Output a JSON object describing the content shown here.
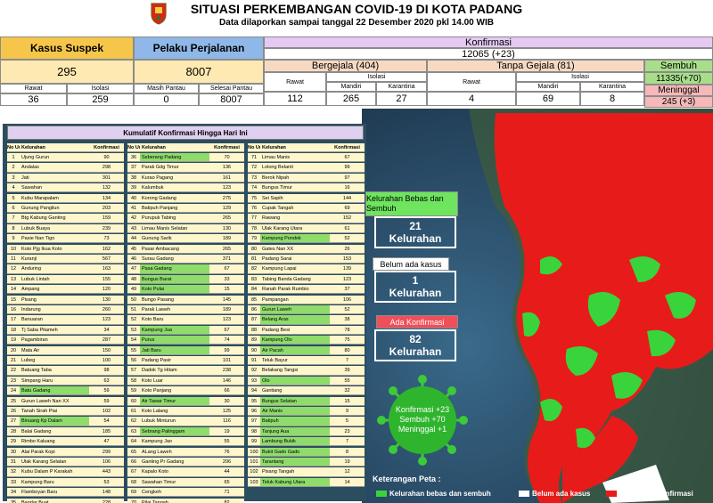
{
  "header": {
    "title": "SITUASI PERKEMBANGAN COVID-19 DI KOTA PADANG",
    "subtitle": "Data dilaporkan sampai tanggal 22 Desember 2020 pkl 14.00 WIB"
  },
  "summary": {
    "kasus_suspek": {
      "label": "Kasus Suspek",
      "total": "295",
      "rawat_label": "Rawat",
      "rawat": "36",
      "isolasi_label": "Isolasi",
      "isolasi": "259"
    },
    "pelaku_perjalanan": {
      "label": "Pelaku Perjalanan",
      "total": "8007",
      "masih_label": "Masih Pantau",
      "masih": "0",
      "selesai_label": "Selesai Pantau",
      "selesai": "8007"
    },
    "konfirmasi": {
      "label": "Konfirmasi",
      "total": "12065 (+23)"
    },
    "bergejala": {
      "label": "Bergejala (404)",
      "rawat_label": "Rawat",
      "rawat": "112",
      "isolasi_label": "Isolasi",
      "mandiri_label": "Mandiri",
      "mandiri": "265",
      "karantina_label": "Karantina",
      "karantina": "27"
    },
    "tanpa_gejala": {
      "label": "Tanpa Gejala (81)",
      "rawat_label": "Rawat",
      "rawat": "4",
      "isolasi_label": "Isolasi",
      "mandiri_label": "Mandiri",
      "mandiri": "69",
      "karantina_label": "Karantina",
      "karantina": "8"
    },
    "sembuh": {
      "label": "Sembuh",
      "value": "11335(+70)"
    },
    "meninggal": {
      "label": "Meninggal",
      "value": "245 (+3)"
    }
  },
  "table": {
    "title": "Kumulatif Konfirmasi Hingga Hari Ini",
    "col_no": "No Urut",
    "col_kel": "Kelurahan",
    "col_konf": "Konfirmasi",
    "col1": [
      [
        "1",
        "Ujung Gurun",
        "90",
        0
      ],
      [
        "2",
        "Andalas",
        "298",
        0
      ],
      [
        "3",
        "Jati",
        "301",
        0
      ],
      [
        "4",
        "Sawahan",
        "132",
        0
      ],
      [
        "5",
        "Kubu Marapalam",
        "134",
        0
      ],
      [
        "6",
        "Gunung Pangilun",
        "203",
        0
      ],
      [
        "7",
        "Btg Kabung Ganting",
        "159",
        0
      ],
      [
        "8",
        "Lubuk Buaya",
        "239",
        0
      ],
      [
        "9",
        "Pasie Nan Tigo",
        "73",
        0
      ],
      [
        "10",
        "Koto Pjg Ikua Koto",
        "162",
        0
      ],
      [
        "11",
        "Kuranji",
        "567",
        0
      ],
      [
        "12",
        "Anduring",
        "163",
        0
      ],
      [
        "13",
        "Lubuk Lintah",
        "155",
        0
      ],
      [
        "14",
        "Ampang",
        "120",
        0
      ],
      [
        "15",
        "Pisang",
        "130",
        0
      ],
      [
        "16",
        "Indarung",
        "260",
        0
      ],
      [
        "17",
        "Banuaran",
        "123",
        0
      ],
      [
        "18",
        "Tj Saba Pitameh",
        "34",
        0
      ],
      [
        "19",
        "Pagambiran",
        "287",
        0
      ],
      [
        "20",
        "Mata Air",
        "150",
        0
      ],
      [
        "21",
        "Lubeg",
        "100",
        0
      ],
      [
        "22",
        "Batuang Taba",
        "98",
        0
      ],
      [
        "23",
        "Simpang Haru",
        "63",
        0
      ],
      [
        "24",
        "Batu Gadang",
        "59",
        1
      ],
      [
        "25",
        "Gurun Laweh Nan XX",
        "59",
        0
      ],
      [
        "26",
        "Tanah Sirah Piai",
        "102",
        0
      ],
      [
        "27",
        "Binuang Kp Dalam",
        "54",
        1
      ],
      [
        "28",
        "Balai Gadang",
        "185",
        0
      ],
      [
        "29",
        "Rimbo Kaluang",
        "47",
        0
      ],
      [
        "30",
        "Alai Parak Kopi",
        "299",
        0
      ],
      [
        "31",
        "Ulak Karang Selatan",
        "106",
        0
      ],
      [
        "32",
        "Kubu Dalam P Karakah",
        "443",
        0
      ],
      [
        "33",
        "Kampung Baru",
        "53",
        0
      ],
      [
        "34",
        "Flamboyan Baru",
        "148",
        0
      ],
      [
        "35",
        "Bandar Buat",
        "228",
        0
      ]
    ],
    "col2": [
      [
        "36",
        "Seberang Padang",
        "70",
        1
      ],
      [
        "37",
        "Parak Gdg Timur",
        "136",
        0
      ],
      [
        "38",
        "Kurao Pagang",
        "161",
        0
      ],
      [
        "39",
        "Kalumbuk",
        "123",
        0
      ],
      [
        "40",
        "Korong Gadang",
        "275",
        0
      ],
      [
        "41",
        "Batipuh Panjang",
        "129",
        0
      ],
      [
        "42",
        "Purupuk Tabing",
        "265",
        0
      ],
      [
        "43",
        "Limau Manis Selatan",
        "130",
        0
      ],
      [
        "44",
        "Gunung Sarik",
        "189",
        0
      ],
      [
        "45",
        "Pasar Ambacang",
        "265",
        0
      ],
      [
        "46",
        "Surau Gadang",
        "371",
        0
      ],
      [
        "47",
        "Pasa Gadang",
        "67",
        1
      ],
      [
        "48",
        "Bungus Barat",
        "33",
        1
      ],
      [
        "49",
        "Koto Pulai",
        "15",
        1
      ],
      [
        "50",
        "Bungo Pasang",
        "145",
        0
      ],
      [
        "51",
        "Parak Laweh",
        "189",
        0
      ],
      [
        "52",
        "Koto Baru",
        "123",
        0
      ],
      [
        "53",
        "Kampung Jua",
        "67",
        1
      ],
      [
        "54",
        "Purus",
        "74",
        1
      ],
      [
        "55",
        "Jati Baru",
        "99",
        1
      ],
      [
        "56",
        "Padang Pasir",
        "101",
        0
      ],
      [
        "57",
        "Dadok Tg Hitam",
        "238",
        0
      ],
      [
        "58",
        "Koto Luar",
        "146",
        0
      ],
      [
        "59",
        "Koto Panjang",
        "66",
        0
      ],
      [
        "60",
        "Air Tawar Timur",
        "30",
        1
      ],
      [
        "61",
        "Koto Lalang",
        "125",
        0
      ],
      [
        "62",
        "Lubuk Minturun",
        "116",
        0
      ],
      [
        "63",
        "Sebrang Palinggam",
        "19",
        1
      ],
      [
        "64",
        "Kampung Jao",
        "55",
        0
      ],
      [
        "65",
        "ALang Laweh",
        "76",
        0
      ],
      [
        "66",
        "Ganting Pr Gadang",
        "206",
        0
      ],
      [
        "67",
        "Kapalo Koto",
        "44",
        0
      ],
      [
        "68",
        "Sawahan Timur",
        "65",
        0
      ],
      [
        "69",
        "Cengkeh",
        "71",
        0
      ],
      [
        "70",
        "Pilai Tangah",
        "82",
        0
      ]
    ],
    "col3": [
      [
        "71",
        "Limau Manis",
        "67",
        0
      ],
      [
        "72",
        "Lolong Belanti",
        "99",
        0
      ],
      [
        "73",
        "Berok Nipah",
        "97",
        0
      ],
      [
        "74",
        "Bungus Timur",
        "16",
        0
      ],
      [
        "75",
        "Sei Sapih",
        "144",
        0
      ],
      [
        "76",
        "Cupak Tangah",
        "69",
        0
      ],
      [
        "77",
        "Rawang",
        "152",
        0
      ],
      [
        "78",
        "Ulak Karang Utara",
        "61",
        0
      ],
      [
        "79",
        "Kampung Pondok",
        "52",
        1
      ],
      [
        "80",
        "Gates Nan XX",
        "26",
        0
      ],
      [
        "81",
        "Padang Sarai",
        "153",
        0
      ],
      [
        "82",
        "Kampung Lapai",
        "139",
        0
      ],
      [
        "83",
        "Tabing Banda Gadang",
        "123",
        0
      ],
      [
        "84",
        "Ranah Parak Rumbio",
        "37",
        0
      ],
      [
        "85",
        "Pampangan",
        "106",
        0
      ],
      [
        "86",
        "Gurun Laweh",
        "52",
        1
      ],
      [
        "87",
        "Belang Aras",
        "38",
        1
      ],
      [
        "88",
        "Padang Besi",
        "78",
        0
      ],
      [
        "89",
        "Kampung Olo",
        "75",
        1
      ],
      [
        "90",
        "Air Pacah",
        "80",
        1
      ],
      [
        "91",
        "Teluk Bayur",
        "7",
        0
      ],
      [
        "92",
        "Belakang Tangsi",
        "39",
        0
      ],
      [
        "93",
        "Olo",
        "55",
        1
      ],
      [
        "94",
        "Gantiang",
        "32",
        0
      ],
      [
        "95",
        "Bungus Selatan",
        "15",
        1
      ],
      [
        "96",
        "Air Manis",
        "9",
        1
      ],
      [
        "97",
        "Batipuh",
        "5",
        1
      ],
      [
        "98",
        "Tanjung Aua",
        "23",
        1
      ],
      [
        "99",
        "Lambung Bukik",
        "7",
        1
      ],
      [
        "100",
        "Bukit Gado Gado",
        "8",
        1
      ],
      [
        "101",
        "Tarantang",
        "19",
        1
      ],
      [
        "102",
        "Pisang Tangah",
        "12",
        0
      ],
      [
        "103",
        "Teluk Kabung Utara",
        "14",
        1
      ]
    ]
  },
  "boxes": {
    "bebas_label": "Kelurahan Bebas dan Sembuh",
    "bebas_count": "21",
    "bebas_unit": "Kelurahan",
    "belum_label": "Belum ada kasus",
    "belum_count": "1",
    "belum_unit": "Kelurahan",
    "ada_label": "Ada Konfirmasi",
    "ada_count": "82",
    "ada_unit": "Kelurahan"
  },
  "virus": {
    "line1": "Konfirmasi +23",
    "line2": "Sembuh +70",
    "line3": "Meninggal +1"
  },
  "legend": {
    "title": "Keterangan Peta :",
    "item1": "Kelurahan bebas dan sembuh",
    "item2": "Belum ada kasus",
    "item3": "Ada kasus konfirmasi"
  },
  "colors": {
    "green": "#39d43b",
    "red": "#e81b1b",
    "white": "#ffffff"
  }
}
